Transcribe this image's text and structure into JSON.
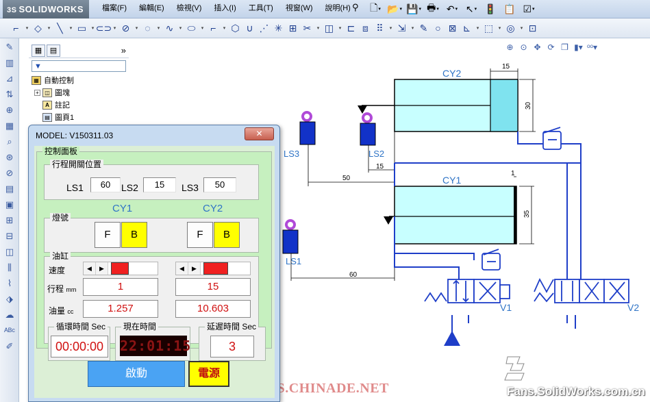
{
  "app": {
    "brand": "SOLIDWORKS",
    "menus": [
      "檔案(F)",
      "編輯(E)",
      "檢視(V)",
      "插入(I)",
      "工具(T)",
      "視窗(W)",
      "說明(H)"
    ]
  },
  "tree": {
    "root": "自動控制",
    "items": [
      "圖塊",
      "註記",
      "圖頁1"
    ]
  },
  "drawing": {
    "cylinders": [
      "CY2",
      "CY1"
    ],
    "limit_switches": [
      "LS3",
      "LS2",
      "LS1"
    ],
    "valves": [
      "V1",
      "V2"
    ],
    "dims": {
      "cy2_width": "15",
      "cy2_height": "30",
      "cy1_width": "1",
      "cy1_height": "35",
      "ls3_offset": "50",
      "ls2_offset": "15",
      "ls1_offset": "60"
    }
  },
  "model_window": {
    "title": "MODEL: V150311.03",
    "close_label": "✕",
    "panel_caption": "控制面板",
    "switch_group": {
      "caption": "行程開關位置",
      "items": [
        {
          "label": "LS1",
          "value": "60"
        },
        {
          "label": "LS2",
          "value": "15"
        },
        {
          "label": "LS3",
          "value": "50"
        }
      ]
    },
    "cylinder_labels": [
      "CY1",
      "CY2"
    ],
    "lamp_group": {
      "caption": "燈號",
      "cy1": {
        "f": "F",
        "b": "B"
      },
      "cy2": {
        "f": "F",
        "b": "B"
      }
    },
    "cyl_group": {
      "caption": "油缸",
      "speed_label": "速度",
      "stroke_label": "行程",
      "stroke_unit": "mm",
      "oil_label": "油量",
      "oil_unit": "cc",
      "cy1": {
        "stroke": "1",
        "oil": "1.257"
      },
      "cy2": {
        "stroke": "15",
        "oil": "10.603"
      }
    },
    "cycle_time": {
      "caption": "循環時間 Sec",
      "value": "00:00:00"
    },
    "now_time": {
      "caption": "現在時間",
      "value": "22:01:15"
    },
    "delay_time": {
      "caption": "延遲時間 Sec",
      "value": "3"
    },
    "start_label": "啟動",
    "power_label": "電源"
  },
  "watermark": "BBS.CHINADE.NET",
  "footer_brand": "Fans.SolidWorks.com.cn",
  "colors": {
    "cylinder_fill": "#c8ffff",
    "pipe": "#1e3ec8",
    "start": "#4aa3f3",
    "power": "#ffff00"
  }
}
